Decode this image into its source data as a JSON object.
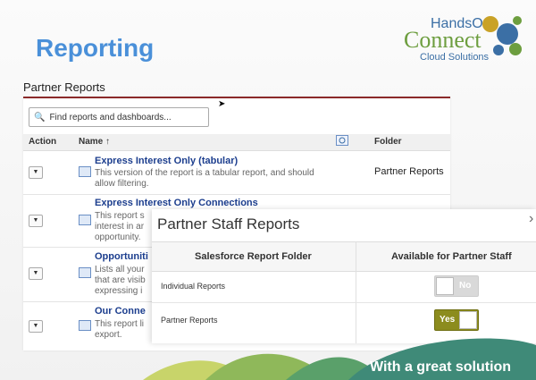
{
  "slide": {
    "title": "Reporting",
    "footer_text": "With a great solution"
  },
  "logo": {
    "line1": "HandsOn",
    "line2": "Connect",
    "line3": "Cloud Solutions"
  },
  "reports_panel": {
    "section_label": "Partner Reports",
    "search_placeholder": "Find reports and dashboards...",
    "columns": {
      "action": "Action",
      "name": "Name ↑",
      "folder": "Folder"
    },
    "rows": [
      {
        "name": "Express Interest Only (tabular)",
        "desc": "This version of the report is a tabular report, and should allow filtering.",
        "folder": "Partner Reports"
      },
      {
        "name": "Express Interest Only Connections",
        "desc": "This report s interest in ar opportunity.",
        "folder": ""
      },
      {
        "name": "Opportuniti",
        "desc": "Lists all your that are visib expressing i",
        "folder": ""
      },
      {
        "name": "Our Conne",
        "desc": "This report li export.",
        "folder": ""
      }
    ]
  },
  "partner_staff_overlay": {
    "title": "Partner Staff Reports",
    "col_folder": "Salesforce Report Folder",
    "col_available": "Available for Partner Staff",
    "rows": [
      {
        "label": "Individual Reports",
        "toggle": "No",
        "enabled": false
      },
      {
        "label": "Partner Reports",
        "toggle": "Yes",
        "enabled": true
      }
    ]
  },
  "colors": {
    "title_blue": "#4a90d9",
    "toggle_on": "#8c8c1e",
    "panel_accent": "#8b2a2a"
  }
}
